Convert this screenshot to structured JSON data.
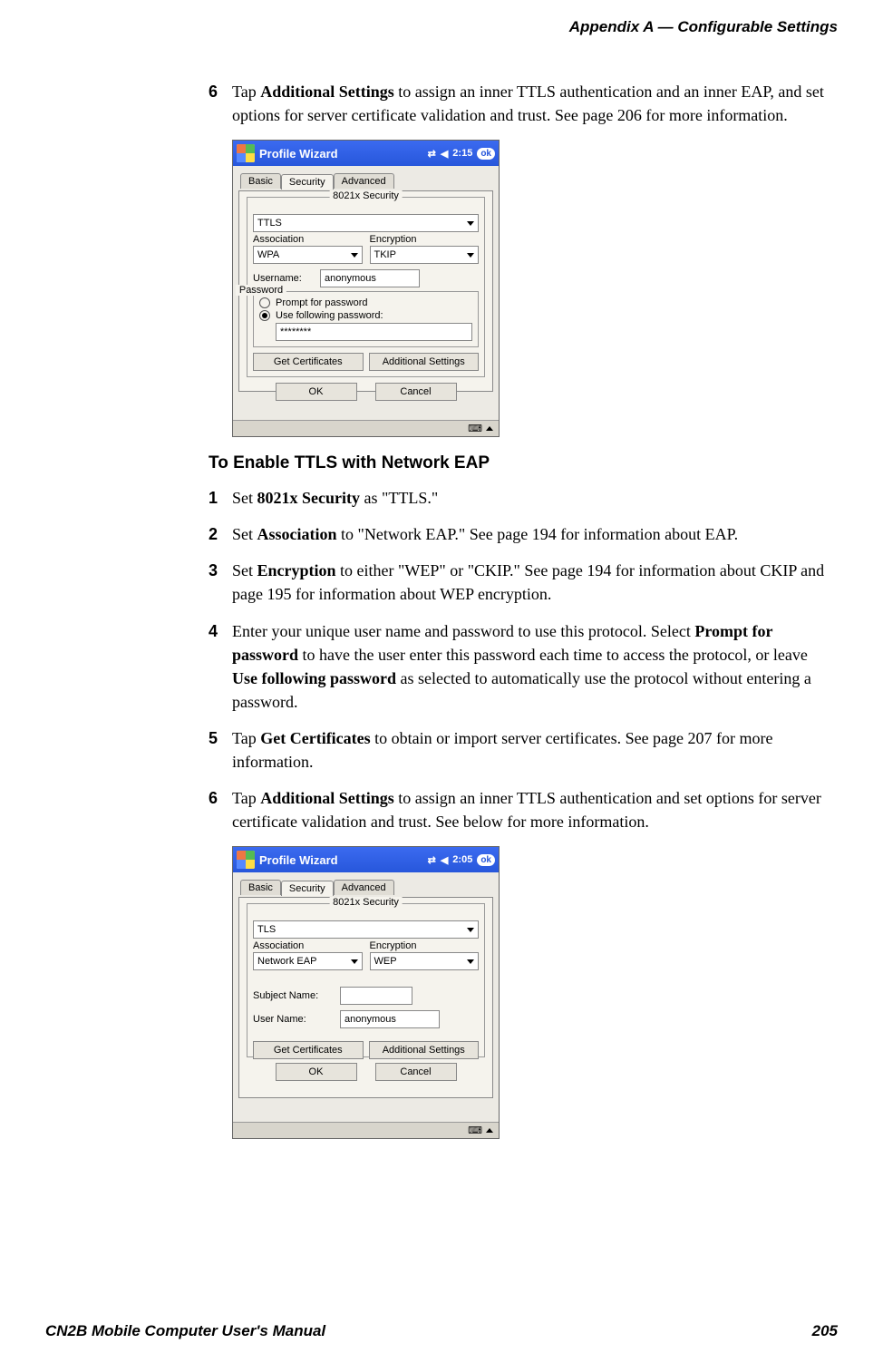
{
  "header": {
    "appendix_label": "Appendix A —  Configurable Settings"
  },
  "step6_top": {
    "num": "6",
    "pre": "Tap ",
    "bold1": "Additional Settings",
    "rest": " to assign an inner TTLS authentication and an inner EAP, and set options for server certificate validation and trust. See page 206 for more information."
  },
  "pda1": {
    "title": "Profile Wizard",
    "time": "2:15",
    "ok": "ok",
    "tabs": {
      "basic": "Basic",
      "security": "Security",
      "advanced": "Advanced"
    },
    "group_label": "8021x Security",
    "sec_value": "TTLS",
    "assoc_label": "Association",
    "assoc_value": "WPA",
    "enc_label": "Encryption",
    "enc_value": "TKIP",
    "username_label": "Username:",
    "username_value": "anonymous",
    "password_legend": "Password",
    "radio1": "Prompt for password",
    "radio2": "Use following password:",
    "password_value": "********",
    "btn_certs": "Get Certificates",
    "btn_addl": "Additional Settings",
    "btn_ok": "OK",
    "btn_cancel": "Cancel"
  },
  "heading": "To Enable TTLS with Network EAP",
  "steps": {
    "s1": {
      "num": "1",
      "pre": "Set ",
      "b": "8021x Security",
      "post": " as \"TTLS.\""
    },
    "s2": {
      "num": "2",
      "pre": "Set ",
      "b": "Association",
      "post": " to \"Network EAP.\" See page 194 for information about EAP."
    },
    "s3": {
      "num": "3",
      "pre": "Set ",
      "b": "Encryption",
      "post": " to either \"WEP\" or \"CKIP.\" See page 194 for information about CKIP and page 195 for information about WEP encryption."
    },
    "s4": {
      "num": "4",
      "pre": "Enter your unique user name and password to use this protocol. Select ",
      "b1": "Prompt for password",
      "mid": " to have the user enter this password each time to access the protocol, or leave ",
      "b2": "Use following password",
      "post": " as selected to automatically use the protocol without entering a password."
    },
    "s5": {
      "num": "5",
      "pre": "Tap ",
      "b": "Get Certificates",
      "post": " to obtain or import server certificates. See page 207 for more information."
    },
    "s6": {
      "num": "6",
      "pre": "Tap ",
      "b": "Additional Settings",
      "post": " to assign an inner TTLS authentication and set options for server certificate validation and trust. See below for more information."
    }
  },
  "pda2": {
    "title": "Profile Wizard",
    "time": "2:05",
    "ok": "ok",
    "tabs": {
      "basic": "Basic",
      "security": "Security",
      "advanced": "Advanced"
    },
    "group_label": "8021x Security",
    "sec_value": "TLS",
    "assoc_label": "Association",
    "assoc_value": "Network EAP",
    "enc_label": "Encryption",
    "enc_value": "WEP",
    "subject_label": "Subject Name:",
    "subject_value": "",
    "user_label": "User Name:",
    "user_value": "anonymous",
    "btn_certs": "Get Certificates",
    "btn_addl": "Additional Settings",
    "btn_ok": "OK",
    "btn_cancel": "Cancel"
  },
  "footer": {
    "left": "CN2B Mobile Computer User's Manual",
    "right": "205"
  }
}
